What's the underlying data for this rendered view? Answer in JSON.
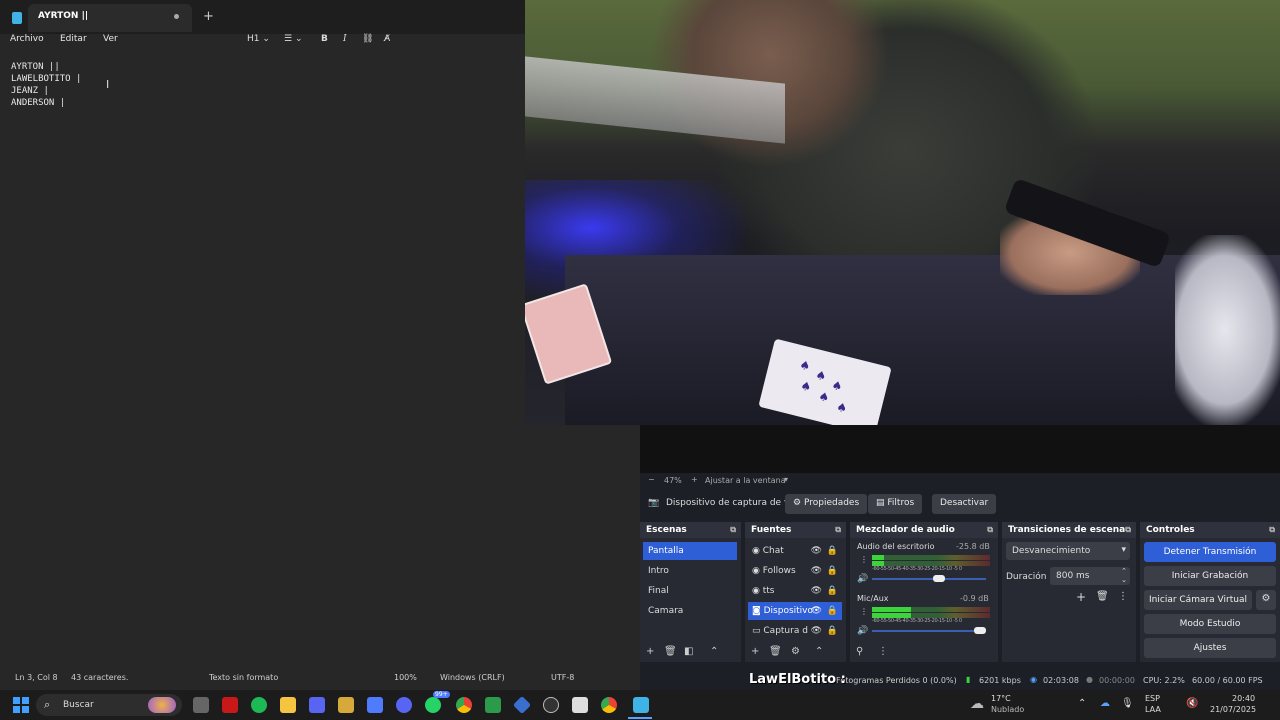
{
  "notepad": {
    "tab_title": "AYRTON ||",
    "menu": [
      "Archivo",
      "Editar",
      "Ver"
    ],
    "toolbar": {
      "heading": "H1"
    },
    "lines": [
      "AYRTON ||",
      "LAWELBOTITO |",
      "JEANZ |",
      "ANDERSON |"
    ],
    "status": {
      "position": "Ln 3, Col 8",
      "chars": "43 caracteres.",
      "format": "Texto sin formato",
      "zoom": "100%",
      "line_ending": "Windows (CRLF)",
      "encoding": "UTF-8"
    }
  },
  "obs": {
    "zoom": {
      "minus": "−",
      "value": "47%",
      "plus": "+",
      "fit": "Ajustar a la ventana"
    },
    "source_bar": {
      "device": "Dispositivo de captura de v",
      "props": "Propiedades",
      "filters": "Filtros",
      "deactivate": "Desactivar"
    },
    "scenes": {
      "title": "Escenas",
      "items": [
        "Pantalla",
        "Intro",
        "Final",
        "Camara"
      ],
      "selected": 0
    },
    "sources": {
      "title": "Fuentes",
      "items": [
        "Chat",
        "Follows",
        "tts",
        "Dispositivo",
        "Captura d"
      ],
      "selected": 3
    },
    "mixer": {
      "title": "Mezclador de audio",
      "channels": [
        {
          "name": "Audio del escritorio",
          "db": "-25.8 dB",
          "level": 0.1,
          "volume": 0.6
        },
        {
          "name": "Mic/Aux",
          "db": "-0.9 dB",
          "level": 0.33,
          "volume": 1.0
        }
      ],
      "scale": "-60-55-50-45-40-35-30-25-20-15-10 -5  0"
    },
    "transitions": {
      "title": "Transiciones de escena",
      "type": "Desvanecimiento",
      "duration_label": "Duración",
      "duration": "800 ms"
    },
    "controls": {
      "title": "Controles",
      "buttons": [
        "Detener Transmisión",
        "Iniciar Grabación",
        "Iniciar Cámara Virtual",
        "Modo Estudio",
        "Ajustes"
      ]
    },
    "status": {
      "overlay_name": "LawElBotito :",
      "frames": "Fotogramas Perdidos 0 (0.0%)",
      "bitrate": "6201 kbps",
      "time_live": "02:03:08",
      "time_rec": "00:00:00",
      "cpu": "CPU: 2.2%",
      "fps": "60.00 / 60.00 FPS"
    }
  },
  "taskbar": {
    "search": "Buscar",
    "badge": "99+",
    "weather_temp": "17°C",
    "weather_desc": "Nublado",
    "lang1": "ESP",
    "lang2": "LAA",
    "time": "20:40",
    "date": "21/07/2025"
  },
  "colors": {
    "accent": "#2f5fd7",
    "obs_bg": "#1d1f26"
  }
}
